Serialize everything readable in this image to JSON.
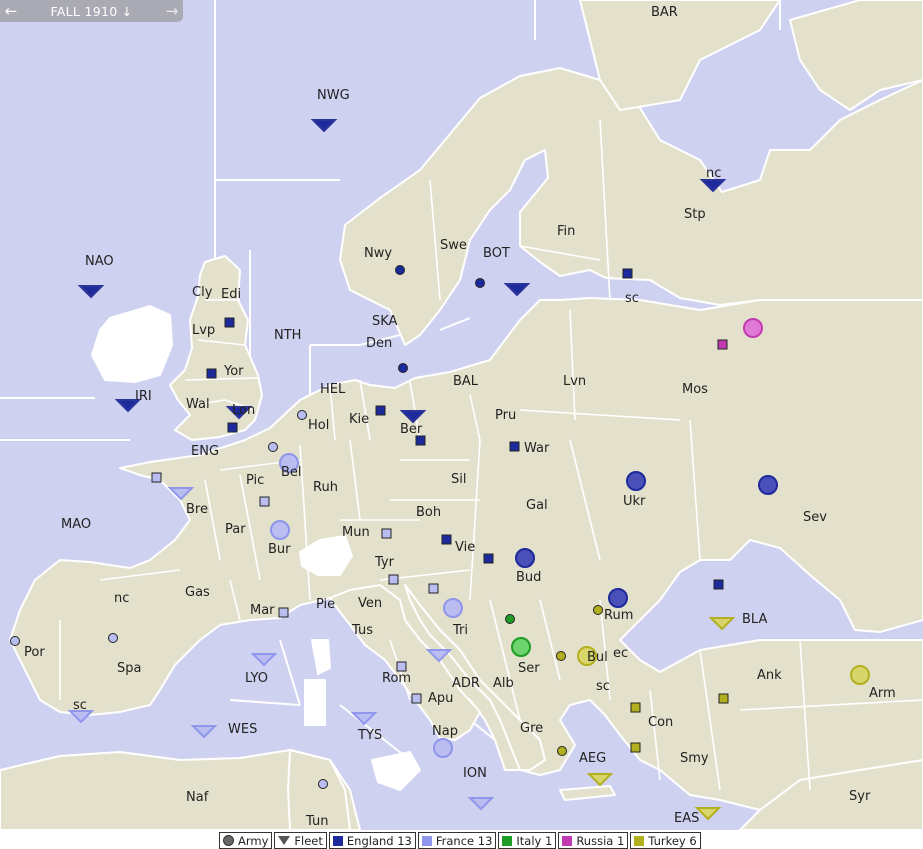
{
  "toolbar": {
    "prev_icon": "←",
    "phase": "FALL 1910",
    "phase_icon": "↓",
    "next_icon": "→"
  },
  "colors": {
    "sea": "#cfd1f0",
    "land": "#e3e1cc",
    "border": "#ffffff",
    "england": "#1d2a9c",
    "france": "#8f96ec",
    "italy": "#1d9c26",
    "russia": "#c23ab2",
    "turkey": "#b3b020"
  },
  "labels": [
    {
      "id": "bar",
      "text": "BAR"
    },
    {
      "id": "nwg",
      "text": "NWG"
    },
    {
      "id": "nao",
      "text": "NAO"
    },
    {
      "id": "fin",
      "text": "Fin"
    },
    {
      "id": "stp",
      "text": "Stp"
    },
    {
      "id": "stpnc",
      "text": "nc"
    },
    {
      "id": "stpsc",
      "text": "sc"
    },
    {
      "id": "swe",
      "text": "Swe"
    },
    {
      "id": "nwy",
      "text": "Nwy"
    },
    {
      "id": "bot",
      "text": "BOT"
    },
    {
      "id": "cly",
      "text": "Cly"
    },
    {
      "id": "edi",
      "text": "Edi"
    },
    {
      "id": "lvp",
      "text": "Lvp"
    },
    {
      "id": "nth",
      "text": "NTH"
    },
    {
      "id": "yor",
      "text": "Yor"
    },
    {
      "id": "ska",
      "text": "SKA"
    },
    {
      "id": "den",
      "text": "Den"
    },
    {
      "id": "iri",
      "text": "IRI"
    },
    {
      "id": "wal",
      "text": "Wal"
    },
    {
      "id": "lon",
      "text": "Lon"
    },
    {
      "id": "hel",
      "text": "HEL"
    },
    {
      "id": "bal",
      "text": "BAL"
    },
    {
      "id": "lvn",
      "text": "Lvn"
    },
    {
      "id": "mos",
      "text": "Mos"
    },
    {
      "id": "hol",
      "text": "Hol"
    },
    {
      "id": "kie",
      "text": "Kie"
    },
    {
      "id": "ber",
      "text": "Ber"
    },
    {
      "id": "pru",
      "text": "Pru"
    },
    {
      "id": "war",
      "text": "War"
    },
    {
      "id": "eng",
      "text": "ENG"
    },
    {
      "id": "bel",
      "text": "Bel"
    },
    {
      "id": "pic",
      "text": "Pic"
    },
    {
      "id": "ruh",
      "text": "Ruh"
    },
    {
      "id": "sil",
      "text": "Sil"
    },
    {
      "id": "bre",
      "text": "Bre"
    },
    {
      "id": "ukr",
      "text": "Ukr"
    },
    {
      "id": "sev",
      "text": "Sev"
    },
    {
      "id": "gal",
      "text": "Gal"
    },
    {
      "id": "mao",
      "text": "MAO"
    },
    {
      "id": "par",
      "text": "Par"
    },
    {
      "id": "boh",
      "text": "Boh"
    },
    {
      "id": "mun",
      "text": "Mun"
    },
    {
      "id": "bur",
      "text": "Bur"
    },
    {
      "id": "vie",
      "text": "Vie"
    },
    {
      "id": "tyr",
      "text": "Tyr"
    },
    {
      "id": "bud",
      "text": "Bud"
    },
    {
      "id": "gas",
      "text": "Gas"
    },
    {
      "id": "spanc",
      "text": "nc"
    },
    {
      "id": "spa",
      "text": "Spa"
    },
    {
      "id": "por",
      "text": "Por"
    },
    {
      "id": "mar",
      "text": "Mar"
    },
    {
      "id": "pie",
      "text": "Pie"
    },
    {
      "id": "ven",
      "text": "Ven"
    },
    {
      "id": "tri",
      "text": "Tri"
    },
    {
      "id": "rum",
      "text": "Rum"
    },
    {
      "id": "bla",
      "text": "BLA"
    },
    {
      "id": "tus",
      "text": "Tus"
    },
    {
      "id": "ser",
      "text": "Ser"
    },
    {
      "id": "bul",
      "text": "Bul"
    },
    {
      "id": "bulec",
      "text": "ec"
    },
    {
      "id": "bulsc",
      "text": "sc"
    },
    {
      "id": "ank",
      "text": "Ank"
    },
    {
      "id": "arm",
      "text": "Arm"
    },
    {
      "id": "lyo",
      "text": "LYO"
    },
    {
      "id": "rom",
      "text": "Rom"
    },
    {
      "id": "adr",
      "text": "ADR"
    },
    {
      "id": "alb",
      "text": "Alb"
    },
    {
      "id": "apu",
      "text": "Apu"
    },
    {
      "id": "con",
      "text": "Con"
    },
    {
      "id": "spasc",
      "text": "sc"
    },
    {
      "id": "wes",
      "text": "WES"
    },
    {
      "id": "tys",
      "text": "TYS"
    },
    {
      "id": "nap",
      "text": "Nap"
    },
    {
      "id": "gre",
      "text": "Gre"
    },
    {
      "id": "aeg",
      "text": "AEG"
    },
    {
      "id": "smy",
      "text": "Smy"
    },
    {
      "id": "ion",
      "text": "ION"
    },
    {
      "id": "naf",
      "text": "Naf"
    },
    {
      "id": "syr",
      "text": "Syr"
    },
    {
      "id": "eas",
      "text": "EAS"
    },
    {
      "id": "tun",
      "text": "Tun"
    }
  ],
  "units": [
    {
      "type": "fleet",
      "power": "england",
      "at": "NWG"
    },
    {
      "type": "fleet",
      "power": "england",
      "at": "NAO"
    },
    {
      "type": "fleet",
      "power": "england",
      "at": "IRI"
    },
    {
      "type": "fleet",
      "power": "england",
      "at": "Lon"
    },
    {
      "type": "fleet",
      "power": "england",
      "at": "BOT"
    },
    {
      "type": "fleet",
      "power": "england",
      "at": "Stp/nc"
    },
    {
      "type": "fleet",
      "power": "england",
      "at": "Ber"
    },
    {
      "type": "army",
      "power": "england",
      "at": "Ukr"
    },
    {
      "type": "army",
      "power": "england",
      "at": "Sev"
    },
    {
      "type": "army",
      "power": "england",
      "at": "Bud"
    },
    {
      "type": "army",
      "power": "england",
      "at": "Rum"
    },
    {
      "type": "army",
      "power": "france",
      "at": "Bel"
    },
    {
      "type": "army",
      "power": "france",
      "at": "Bur"
    },
    {
      "type": "army",
      "power": "france",
      "at": "Tri"
    },
    {
      "type": "army",
      "power": "france",
      "at": "Nap"
    },
    {
      "type": "fleet",
      "power": "france",
      "at": "ENG"
    },
    {
      "type": "fleet",
      "power": "france",
      "at": "LYO"
    },
    {
      "type": "fleet",
      "power": "france",
      "at": "WES"
    },
    {
      "type": "fleet",
      "power": "france",
      "at": "TYS"
    },
    {
      "type": "fleet",
      "power": "france",
      "at": "ADR"
    },
    {
      "type": "fleet",
      "power": "france",
      "at": "Spa/sc"
    },
    {
      "type": "army",
      "power": "italy",
      "at": "Ser"
    },
    {
      "type": "army",
      "power": "russia",
      "at": "Mos"
    },
    {
      "type": "army",
      "power": "turkey",
      "at": "Bul"
    },
    {
      "type": "army",
      "power": "turkey",
      "at": "Arm"
    },
    {
      "type": "fleet",
      "power": "turkey",
      "at": "BLA"
    },
    {
      "type": "fleet",
      "power": "turkey",
      "at": "AEG"
    },
    {
      "type": "fleet",
      "power": "turkey",
      "at": "EAS"
    }
  ],
  "legend": {
    "army": "Army",
    "fleet": "Fleet",
    "powers": [
      {
        "key": "england",
        "label": "England 13"
      },
      {
        "key": "france",
        "label": "France 13"
      },
      {
        "key": "italy",
        "label": "Italy 1"
      },
      {
        "key": "russia",
        "label": "Russia 1"
      },
      {
        "key": "turkey",
        "label": "Turkey 6"
      }
    ]
  }
}
